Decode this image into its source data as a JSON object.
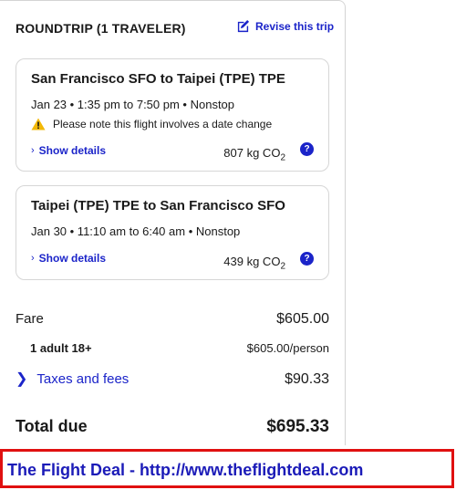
{
  "summary": {
    "title": "ROUNDTRIP (1 TRAVELER)",
    "revise_label": "Revise this trip"
  },
  "flights": [
    {
      "route": "San Francisco SFO to Taipei (TPE) TPE",
      "times": "Jan 23 • 1:35 pm to 7:50 pm • Nonstop",
      "warning": "Please note this flight involves a date change",
      "details_label": "Show details",
      "co2_value": "807 kg CO",
      "co2_sub": "2",
      "help": "?"
    },
    {
      "route": "Taipei (TPE) TPE to San Francisco SFO",
      "times": "Jan 30 • 11:10 am to 6:40 am • Nonstop",
      "details_label": "Show details",
      "co2_value": "439 kg CO",
      "co2_sub": "2",
      "help": "?"
    }
  ],
  "pricing": {
    "fare_label": "Fare",
    "fare_amount": "$605.00",
    "adult_label": "1 adult 18+",
    "adult_amount": "$605.00/person",
    "taxes_label": "Taxes and fees",
    "taxes_amount": "$90.33",
    "total_label": "Total due",
    "total_amount": "$695.33"
  },
  "banner": {
    "text": "The Flight Deal - http://www.theflightdeal.com"
  },
  "colors": {
    "accent": "#1b24c9",
    "warning": "#f2b807",
    "banner_border": "#e01010"
  }
}
